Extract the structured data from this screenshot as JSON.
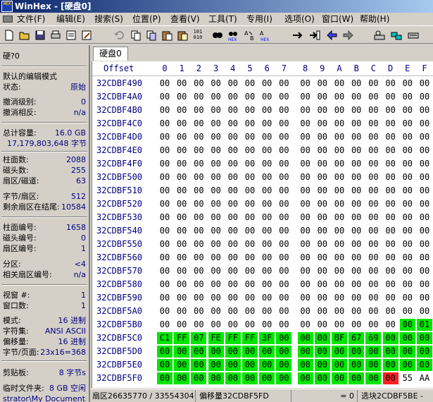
{
  "window": {
    "title": "WinHex - [硬盘0]",
    "app_icon_text": "HEX"
  },
  "menu": [
    "文件(F)",
    "编辑(E)",
    "搜索(S)",
    "位置(P)",
    "查看(V)",
    "工具(T)",
    "专用(I)",
    "选项(O)",
    "窗口(W)",
    "帮助(H)"
  ],
  "toolbar_icons": [
    "new-file-icon",
    "open-folder-icon",
    "save-icon",
    "print-icon",
    "properties-icon",
    "edit-icon",
    "undo-icon",
    "copy-icon",
    "copy-block-icon",
    "paste-icon",
    "paste-write-icon",
    "binary-icon",
    "find-icon",
    "find-hex-icon",
    "replace-icon",
    "replace-hex-icon",
    "goto-offset-icon",
    "goto-sector-icon",
    "back-icon",
    "forward-icon",
    "disk-editor-icon",
    "ram-editor-icon",
    "disk-tools-icon"
  ],
  "tab": {
    "label": "硬盘0"
  },
  "left_panel": {
    "drive": "硬?0",
    "edit_mode_label": "默认的编辑模式",
    "state_label": "状态:",
    "state_value": "原始",
    "undo_level_label": "撤消级别:",
    "undo_level_value": "0",
    "undo_reverse_label": "撤消相反:",
    "undo_reverse_value": "n/a",
    "total_capacity_label": "总计容量:",
    "total_capacity_value": "16.0 GB",
    "total_bytes_value": "17,179,803,648 字节",
    "cylinders_label": "柱面数:",
    "cylinders_value": "2088",
    "heads_label": "磁头数:",
    "heads_value": "255",
    "sectors_per_track_label": "扇区/磁道:",
    "sectors_per_track_value": "63",
    "bytes_per_sector_label": "字节/扇区:",
    "bytes_per_sector_value": "512",
    "remaining_sectors_label": "剩余扇区在结尾:",
    "remaining_sectors_value": "10584",
    "cylinder_no_label": "柱面编号:",
    "cylinder_no_value": "1658",
    "head_no_label": "磁头编号:",
    "head_no_value": "0",
    "sector_no_label": "扇区编号:",
    "sector_no_value": "1",
    "partition_label": "分区:",
    "partition_value": "<4",
    "rel_sector_label": "相关扇区编号:",
    "rel_sector_value": "n/a",
    "window_no_label": "视窗 #:",
    "window_no_value": "1",
    "window_count_label": "窗口数:",
    "window_count_value": "1",
    "mode_label": "模式:",
    "mode_value": "16 进制",
    "charset_label": "字符集:",
    "charset_value": "ANSI ASCII",
    "offsets_label": "偏移量:",
    "offsets_value": "16 进制",
    "bytes_per_page_label": "字节/页面:",
    "bytes_per_page_value": "23x16=368",
    "clipboard_label": "剪贴板:",
    "clipboard_value": "8 字节s",
    "temp_folder_label": "临时文件夹:",
    "temp_folder_value": "8 GB 空闲",
    "temp_path_value": "strator\\My Documents"
  },
  "hex_view": {
    "offset_header": "Offset",
    "columns": [
      "0",
      "1",
      "2",
      "3",
      "4",
      "5",
      "6",
      "7",
      "8",
      "9",
      "A",
      "B",
      "C",
      "D",
      "E",
      "F"
    ],
    "rows": [
      {
        "offset": "32CDBF490",
        "bytes": [
          "00",
          "00",
          "00",
          "00",
          "00",
          "00",
          "00",
          "00",
          "00",
          "00",
          "00",
          "00",
          "00",
          "00",
          "00",
          "00"
        ]
      },
      {
        "offset": "32CDBF4A0",
        "bytes": [
          "00",
          "00",
          "00",
          "00",
          "00",
          "00",
          "00",
          "00",
          "00",
          "00",
          "00",
          "00",
          "00",
          "00",
          "00",
          "00"
        ]
      },
      {
        "offset": "32CDBF4B0",
        "bytes": [
          "00",
          "00",
          "00",
          "00",
          "00",
          "00",
          "00",
          "00",
          "00",
          "00",
          "00",
          "00",
          "00",
          "00",
          "00",
          "00"
        ]
      },
      {
        "offset": "32CDBF4C0",
        "bytes": [
          "00",
          "00",
          "00",
          "00",
          "00",
          "00",
          "00",
          "00",
          "00",
          "00",
          "00",
          "00",
          "00",
          "00",
          "00",
          "00"
        ]
      },
      {
        "offset": "32CDBF4D0",
        "bytes": [
          "00",
          "00",
          "00",
          "00",
          "00",
          "00",
          "00",
          "00",
          "00",
          "00",
          "00",
          "00",
          "00",
          "00",
          "00",
          "00"
        ]
      },
      {
        "offset": "32CDBF4E0",
        "bytes": [
          "00",
          "00",
          "00",
          "00",
          "00",
          "00",
          "00",
          "00",
          "00",
          "00",
          "00",
          "00",
          "00",
          "00",
          "00",
          "00"
        ]
      },
      {
        "offset": "32CDBF4F0",
        "bytes": [
          "00",
          "00",
          "00",
          "00",
          "00",
          "00",
          "00",
          "00",
          "00",
          "00",
          "00",
          "00",
          "00",
          "00",
          "00",
          "00"
        ]
      },
      {
        "offset": "32CDBF500",
        "bytes": [
          "00",
          "00",
          "00",
          "00",
          "00",
          "00",
          "00",
          "00",
          "00",
          "00",
          "00",
          "00",
          "00",
          "00",
          "00",
          "00"
        ]
      },
      {
        "offset": "32CDBF510",
        "bytes": [
          "00",
          "00",
          "00",
          "00",
          "00",
          "00",
          "00",
          "00",
          "00",
          "00",
          "00",
          "00",
          "00",
          "00",
          "00",
          "00"
        ]
      },
      {
        "offset": "32CDBF520",
        "bytes": [
          "00",
          "00",
          "00",
          "00",
          "00",
          "00",
          "00",
          "00",
          "00",
          "00",
          "00",
          "00",
          "00",
          "00",
          "00",
          "00"
        ]
      },
      {
        "offset": "32CDBF530",
        "bytes": [
          "00",
          "00",
          "00",
          "00",
          "00",
          "00",
          "00",
          "00",
          "00",
          "00",
          "00",
          "00",
          "00",
          "00",
          "00",
          "00"
        ]
      },
      {
        "offset": "32CDBF540",
        "bytes": [
          "00",
          "00",
          "00",
          "00",
          "00",
          "00",
          "00",
          "00",
          "00",
          "00",
          "00",
          "00",
          "00",
          "00",
          "00",
          "00"
        ]
      },
      {
        "offset": "32CDBF550",
        "bytes": [
          "00",
          "00",
          "00",
          "00",
          "00",
          "00",
          "00",
          "00",
          "00",
          "00",
          "00",
          "00",
          "00",
          "00",
          "00",
          "00"
        ]
      },
      {
        "offset": "32CDBF560",
        "bytes": [
          "00",
          "00",
          "00",
          "00",
          "00",
          "00",
          "00",
          "00",
          "00",
          "00",
          "00",
          "00",
          "00",
          "00",
          "00",
          "00"
        ]
      },
      {
        "offset": "32CDBF570",
        "bytes": [
          "00",
          "00",
          "00",
          "00",
          "00",
          "00",
          "00",
          "00",
          "00",
          "00",
          "00",
          "00",
          "00",
          "00",
          "00",
          "00"
        ]
      },
      {
        "offset": "32CDBF580",
        "bytes": [
          "00",
          "00",
          "00",
          "00",
          "00",
          "00",
          "00",
          "00",
          "00",
          "00",
          "00",
          "00",
          "00",
          "00",
          "00",
          "00"
        ]
      },
      {
        "offset": "32CDBF590",
        "bytes": [
          "00",
          "00",
          "00",
          "00",
          "00",
          "00",
          "00",
          "00",
          "00",
          "00",
          "00",
          "00",
          "00",
          "00",
          "00",
          "00"
        ]
      },
      {
        "offset": "32CDBF5A0",
        "bytes": [
          "00",
          "00",
          "00",
          "00",
          "00",
          "00",
          "00",
          "00",
          "00",
          "00",
          "00",
          "00",
          "00",
          "00",
          "00",
          "00"
        ]
      },
      {
        "offset": "32CDBF5B0",
        "bytes": [
          "00",
          "00",
          "00",
          "00",
          "00",
          "00",
          "00",
          "00",
          "00",
          "00",
          "00",
          "00",
          "00",
          "00",
          "00",
          "01"
        ]
      },
      {
        "offset": "32CDBF5C0",
        "bytes": [
          "C1",
          "FF",
          "07",
          "FE",
          "FF",
          "FF",
          "3F",
          "00",
          "00",
          "00",
          "BF",
          "67",
          "69",
          "00",
          "00",
          "00"
        ]
      },
      {
        "offset": "32CDBF5D0",
        "bytes": [
          "00",
          "00",
          "00",
          "00",
          "00",
          "00",
          "00",
          "00",
          "00",
          "00",
          "00",
          "00",
          "00",
          "00",
          "00",
          "00"
        ]
      },
      {
        "offset": "32CDBF5E0",
        "bytes": [
          "00",
          "00",
          "00",
          "00",
          "00",
          "00",
          "00",
          "00",
          "00",
          "00",
          "00",
          "00",
          "00",
          "00",
          "00",
          "00"
        ]
      },
      {
        "offset": "32CDBF5F0",
        "bytes": [
          "00",
          "00",
          "00",
          "00",
          "00",
          "00",
          "00",
          "00",
          "00",
          "00",
          "00",
          "00",
          "00",
          "00",
          "55",
          "AA"
        ]
      }
    ],
    "selection_start": {
      "row": 18,
      "col": 14
    },
    "selection_end": {
      "row": 22,
      "col": 13
    },
    "cursor": {
      "row": 22,
      "col": 13
    }
  },
  "status_bar": {
    "sector": "扇区26635770 / 33554304",
    "offset": "偏移量32CDBF5FD",
    "value": "= 0",
    "selection": "选块2CDBF5BE -"
  },
  "colors": {
    "selection": "#00e600",
    "cursor": "#ff2020",
    "offset_text": "#000080"
  }
}
